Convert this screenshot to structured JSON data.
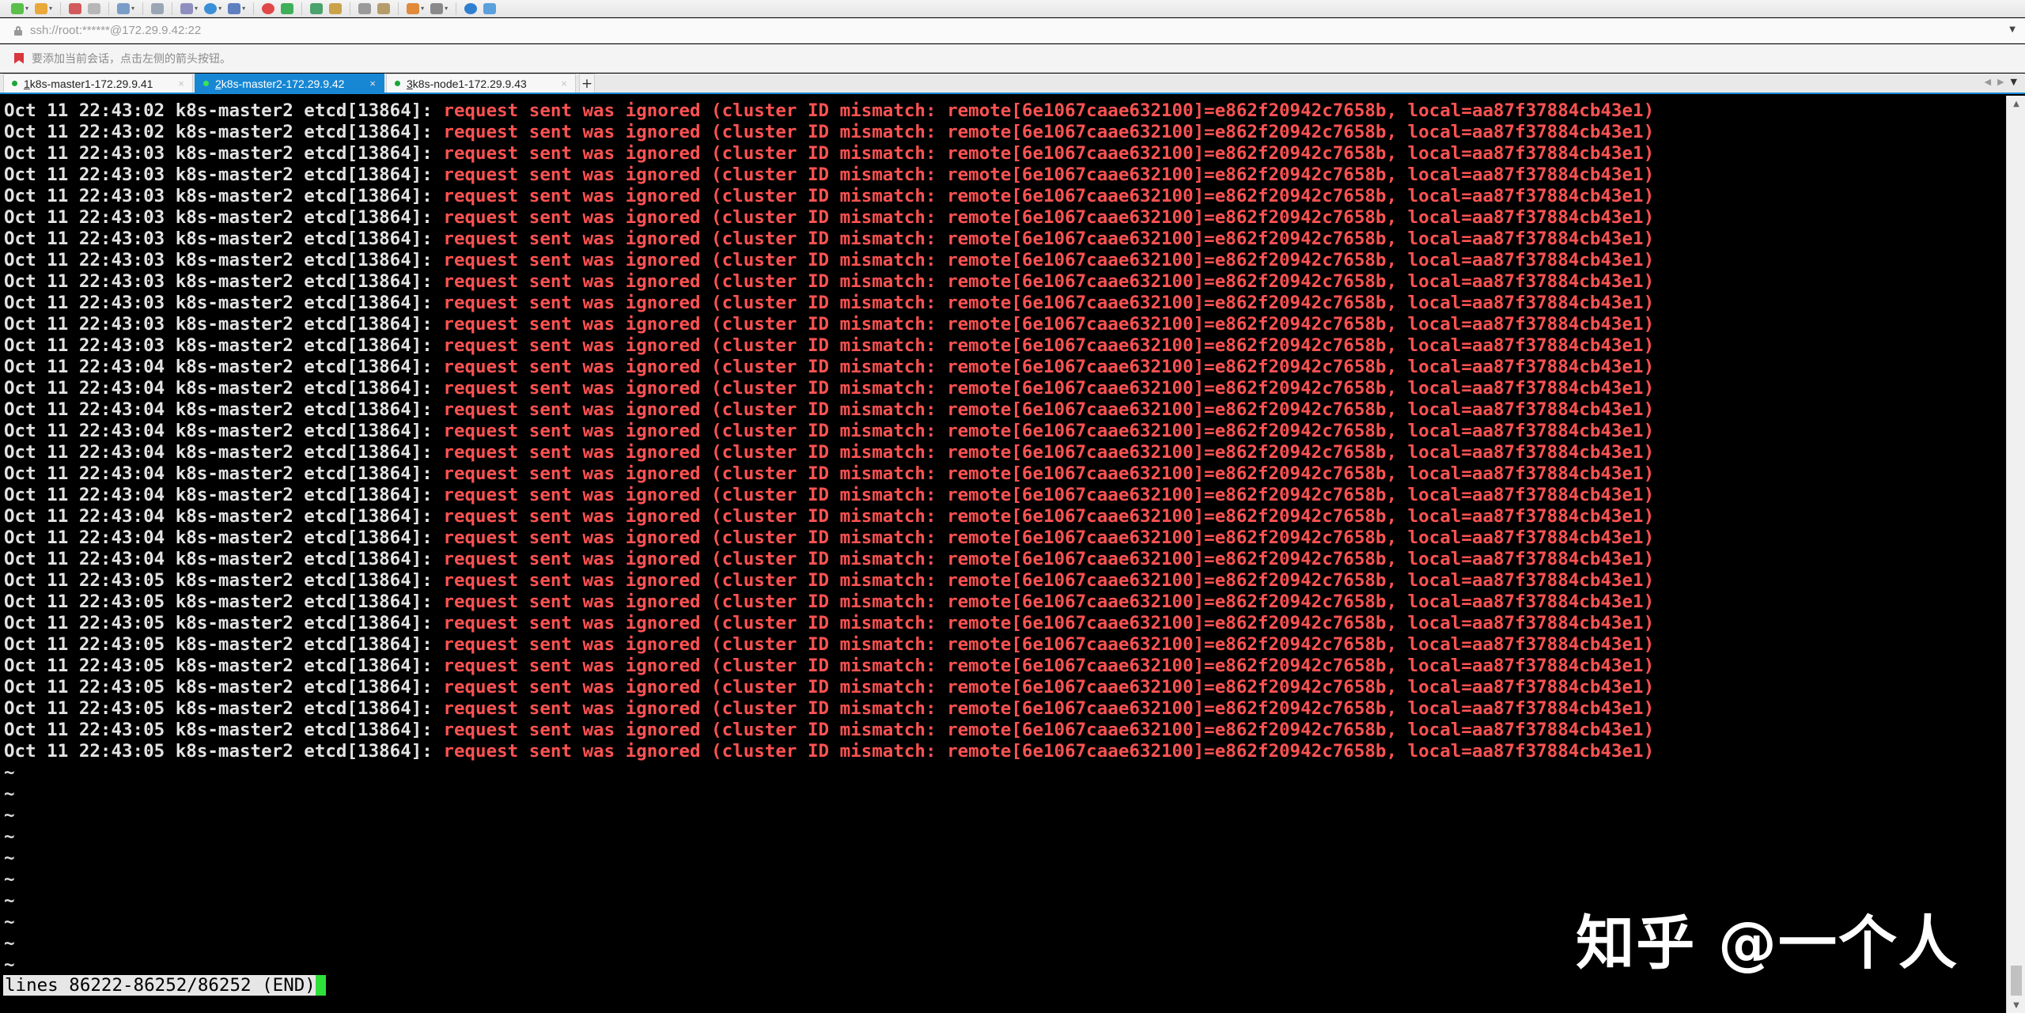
{
  "address": {
    "text": "ssh://root:******@172.29.9.42:22"
  },
  "hint": {
    "text": "要添加当前会话，点击左侧的箭头按钮。"
  },
  "tabs": [
    {
      "number": "1",
      "label": " k8s-master1-172.29.9.41",
      "active": false
    },
    {
      "number": "2",
      "label": " k8s-master2-172.29.9.42",
      "active": true
    },
    {
      "number": "3",
      "label": " k8s-node1-172.29.9.43",
      "active": false
    }
  ],
  "tab_add": "+",
  "tab_close": "×",
  "log_message": "request sent was ignored (cluster ID mismatch: remote[6e1067caae632100]=e862f20942c7658b, local=aa87f37884cb43e1)",
  "log_prefixes": [
    "Oct 11 22:43:02 k8s-master2 etcd[13864]: ",
    "Oct 11 22:43:02 k8s-master2 etcd[13864]: ",
    "Oct 11 22:43:03 k8s-master2 etcd[13864]: ",
    "Oct 11 22:43:03 k8s-master2 etcd[13864]: ",
    "Oct 11 22:43:03 k8s-master2 etcd[13864]: ",
    "Oct 11 22:43:03 k8s-master2 etcd[13864]: ",
    "Oct 11 22:43:03 k8s-master2 etcd[13864]: ",
    "Oct 11 22:43:03 k8s-master2 etcd[13864]: ",
    "Oct 11 22:43:03 k8s-master2 etcd[13864]: ",
    "Oct 11 22:43:03 k8s-master2 etcd[13864]: ",
    "Oct 11 22:43:03 k8s-master2 etcd[13864]: ",
    "Oct 11 22:43:03 k8s-master2 etcd[13864]: ",
    "Oct 11 22:43:04 k8s-master2 etcd[13864]: ",
    "Oct 11 22:43:04 k8s-master2 etcd[13864]: ",
    "Oct 11 22:43:04 k8s-master2 etcd[13864]: ",
    "Oct 11 22:43:04 k8s-master2 etcd[13864]: ",
    "Oct 11 22:43:04 k8s-master2 etcd[13864]: ",
    "Oct 11 22:43:04 k8s-master2 etcd[13864]: ",
    "Oct 11 22:43:04 k8s-master2 etcd[13864]: ",
    "Oct 11 22:43:04 k8s-master2 etcd[13864]: ",
    "Oct 11 22:43:04 k8s-master2 etcd[13864]: ",
    "Oct 11 22:43:04 k8s-master2 etcd[13864]: ",
    "Oct 11 22:43:05 k8s-master2 etcd[13864]: ",
    "Oct 11 22:43:05 k8s-master2 etcd[13864]: ",
    "Oct 11 22:43:05 k8s-master2 etcd[13864]: ",
    "Oct 11 22:43:05 k8s-master2 etcd[13864]: ",
    "Oct 11 22:43:05 k8s-master2 etcd[13864]: ",
    "Oct 11 22:43:05 k8s-master2 etcd[13864]: ",
    "Oct 11 22:43:05 k8s-master2 etcd[13864]: ",
    "Oct 11 22:43:05 k8s-master2 etcd[13864]: ",
    "Oct 11 22:43:05 k8s-master2 etcd[13864]: "
  ],
  "tilde": "~",
  "tilde_count": 10,
  "status_line": "lines 86222-86252/86252 (END)",
  "watermark": "知乎 @一个人",
  "colors": {
    "log_prefix": "#e3e3e3",
    "log_message": "#ff5252",
    "tab_active": "#1787d4",
    "cursor": "#2fe03a"
  }
}
